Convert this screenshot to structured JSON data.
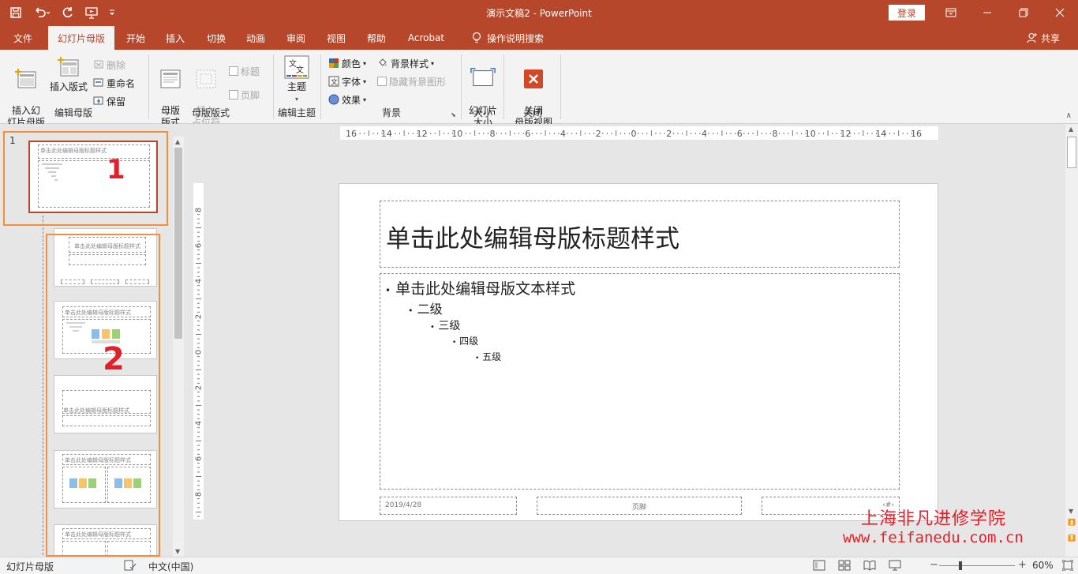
{
  "window": {
    "title": "演示文稿2 - PowerPoint",
    "login_label": "登录"
  },
  "tabs": [
    {
      "label": "文件"
    },
    {
      "label": "幻灯片母版"
    },
    {
      "label": "开始"
    },
    {
      "label": "插入"
    },
    {
      "label": "切换"
    },
    {
      "label": "动画"
    },
    {
      "label": "审阅"
    },
    {
      "label": "视图"
    },
    {
      "label": "帮助"
    },
    {
      "label": "Acrobat"
    }
  ],
  "tell_me": "操作说明搜索",
  "share": "共享",
  "ribbon": {
    "edit_master": {
      "group_label": "编辑母版",
      "insert_master": "插入幻\n灯片母版",
      "insert_layout": "插入版式",
      "delete": "删除",
      "rename": "重命名",
      "preserve": "保留"
    },
    "master_layout": {
      "group_label": "母版版式",
      "master_layout_btn": "母版\n版式",
      "insert_placeholder": "插入\n占位符",
      "title_chk": "标题",
      "footer_chk": "页脚"
    },
    "edit_theme": {
      "group_label": "编辑主题",
      "theme": "主题"
    },
    "background": {
      "group_label": "背景",
      "colors": "颜色",
      "fonts": "字体",
      "effects": "效果",
      "bg_styles": "背景样式",
      "hide_bg": "隐藏背景图形"
    },
    "size": {
      "group_label": "大小",
      "slide_size": "幻灯片\n大小"
    },
    "close": {
      "group_label": "关闭",
      "close_master": "关闭\n母版视图"
    }
  },
  "thumbnails": {
    "slide_number": "1",
    "master_title": "单击此处编辑母版标题样式",
    "layout_title": "单击此处编辑母版标题样式",
    "annotation_1": "1",
    "annotation_2": "2"
  },
  "ruler": {
    "h_labels": [
      "16",
      "14",
      "12",
      "10",
      "8",
      "6",
      "4",
      "2",
      "0",
      "2",
      "4",
      "6",
      "8",
      "10",
      "12",
      "14",
      "16"
    ],
    "v_labels": [
      "8",
      "6",
      "4",
      "2",
      "0",
      "2",
      "4",
      "6",
      "8"
    ]
  },
  "slide": {
    "title": "单击此处编辑母版标题样式",
    "levels": [
      "单击此处编辑母版文本样式",
      "二级",
      "三级",
      "四级",
      "五级"
    ],
    "date": "2019/4/28",
    "footer": "页脚",
    "page_num": "‹#›"
  },
  "statusbar": {
    "view_name": "幻灯片母版",
    "language": "中文(中国)",
    "zoom": "60%",
    "zoom_fraction": 0.6
  },
  "watermark": {
    "line1": "上海非凡进修学院",
    "line2": "www.feifanedu.com.cn"
  },
  "colors": {
    "accent": "#b7472a",
    "annotation": "#f58d3a",
    "watermark": "#e3202a"
  }
}
